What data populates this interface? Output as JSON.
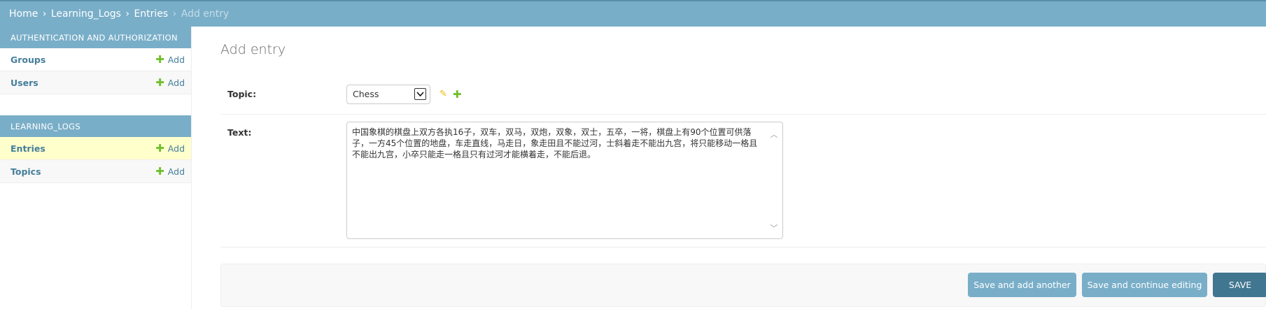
{
  "breadcrumbs": {
    "home": "Home",
    "app": "Learning_Logs",
    "model": "Entries",
    "current": "Add entry",
    "separator": "›"
  },
  "sidebar": {
    "modules": [
      {
        "caption": "Authentication and Authorization",
        "rows": [
          {
            "name": "Groups",
            "add": "Add"
          },
          {
            "name": "Users",
            "add": "Add"
          }
        ]
      },
      {
        "caption": "Learning_Logs",
        "rows": [
          {
            "name": "Entries",
            "add": "Add"
          },
          {
            "name": "Topics",
            "add": "Add"
          }
        ]
      }
    ]
  },
  "form": {
    "title": "Add entry",
    "topic_label": "Topic:",
    "topic_value": "Chess",
    "text_label": "Text:",
    "text_value": "中国象棋的棋盘上双方各执16子，双车，双马，双炮，双象，双士，五卒，一将，棋盘上有90个位置可供落子，一方45个位置的地盘，车走直线，马走日，象走田且不能过河，士斜着走不能出九宫，将只能移动一格且不能出九宫，小卒只能走一格且只有过河才能横着走，不能后退。"
  },
  "actions": {
    "save_add_another": "Save and add another",
    "save_continue": "Save and continue editing",
    "save": "SAVE"
  },
  "colors": {
    "header": "#79aec8",
    "link": "#447e9b",
    "add_icon": "#70bf2b",
    "edit_icon": "#efb80b",
    "current_row": "#ffffcc",
    "save_button": "#417690"
  }
}
